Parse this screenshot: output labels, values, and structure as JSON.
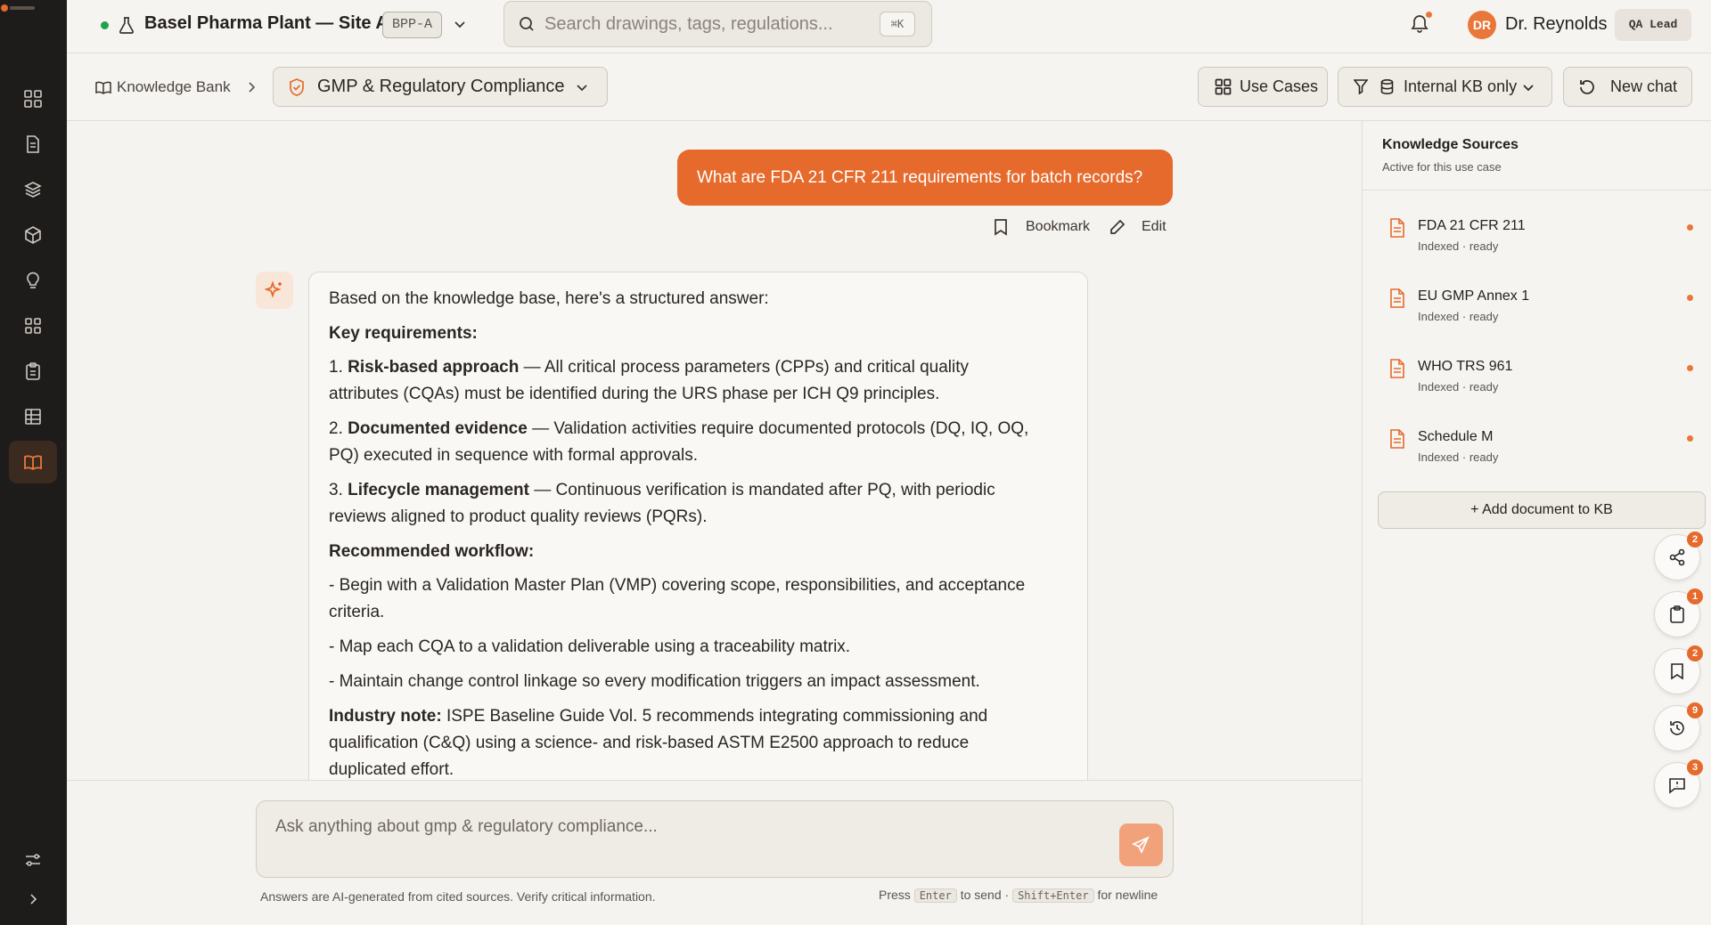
{
  "header": {
    "site_title": "Basel Pharma Plant — Site A",
    "site_code": "BPP-A",
    "search_placeholder": "Search drawings, tags, regulations...",
    "search_shortcut": "⌘K",
    "user_initials": "DR",
    "user_name": "Dr. Reynolds",
    "user_role": "QA Lead"
  },
  "toolbar": {
    "breadcrumb": "Knowledge Bank",
    "use_case": "GMP & Regulatory Compliance",
    "use_cases_label": "Use Cases",
    "filter_label": "Internal KB only",
    "new_chat_label": "New chat"
  },
  "chat": {
    "user_message": "What are FDA 21 CFR 211 requirements for batch records?",
    "bookmark_label": "Bookmark",
    "edit_label": "Edit",
    "answer": {
      "intro": "Based on the knowledge base, here's a structured answer:",
      "key_heading": "Key requirements:",
      "items": [
        {
          "num": "1.",
          "title": "Risk-based approach",
          "line1": " — All critical process parameters (CPPs) and critical quality",
          "line2": "attributes (CQAs) must be identified during the URS phase per ICH Q9 principles."
        },
        {
          "num": "2.",
          "title": "Documented evidence",
          "line1": " — Validation activities require documented protocols (DQ, IQ, OQ,",
          "line2": "PQ) executed in sequence with formal approvals."
        },
        {
          "num": "3.",
          "title": "Lifecycle management",
          "line1": " — Continuous verification is mandated after PQ, with periodic",
          "line2": "reviews aligned to product quality reviews (PQRs)."
        }
      ],
      "workflow_heading": "Recommended workflow:",
      "workflow": [
        {
          "line1": "- Begin with a Validation Master Plan (VMP) covering scope, responsibilities, and acceptance",
          "line2": "criteria."
        },
        {
          "line1": "- Map each CQA to a validation deliverable using a traceability matrix.",
          "line2": ""
        },
        {
          "line1": "- Maintain change control linkage so every modification triggers an impact assessment.",
          "line2": ""
        }
      ],
      "note_label": "Industry note:",
      "note_line1": " ISPE Baseline Guide Vol. 5 recommends integrating commissioning and",
      "note_line2": "qualification (C&Q) using a science- and risk-based ASTM E2500 approach to reduce",
      "note_line3": "duplicated effort."
    }
  },
  "composer": {
    "placeholder": "Ask anything about gmp & regulatory compliance...",
    "disclaimer": "Answers are AI-generated from cited sources. Verify critical information.",
    "hint_press": "Press",
    "hint_enter": "Enter",
    "hint_to_send": "to send ·",
    "hint_shift": "Shift+Enter",
    "hint_newline": "for newline"
  },
  "sources": {
    "title": "Knowledge Sources",
    "subtitle": "Active for this use case",
    "items": [
      {
        "name": "FDA 21 CFR 211",
        "status": "Indexed · ready"
      },
      {
        "name": "EU GMP Annex 1",
        "status": "Indexed · ready"
      },
      {
        "name": "WHO TRS 961",
        "status": "Indexed · ready"
      },
      {
        "name": "Schedule M",
        "status": "Indexed · ready"
      }
    ],
    "add_label": "+ Add document to KB"
  },
  "fabs": [
    {
      "icon": "share-icon",
      "badge": "2"
    },
    {
      "icon": "clipboard-icon",
      "badge": "1"
    },
    {
      "icon": "bookmark-icon",
      "badge": "2"
    },
    {
      "icon": "history-icon",
      "badge": "9"
    },
    {
      "icon": "message-icon",
      "badge": "3"
    }
  ],
  "colors": {
    "accent": "#e56a2c",
    "rail": "#1e1c1b",
    "background": "#f5f3ef"
  }
}
